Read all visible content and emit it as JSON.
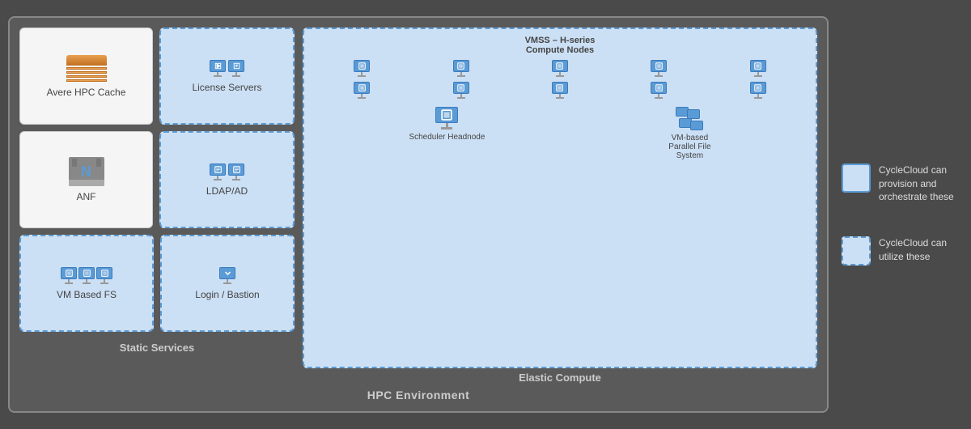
{
  "legend": {
    "provision_label": "CycleCloud can provision and orchestrate these",
    "utilize_label": "CycleCloud can utilize these"
  },
  "main_label": "HPC Environment",
  "static_label": "Static Services",
  "elastic_label": "Elastic Compute",
  "cards": {
    "avere": "Avere HPC Cache",
    "license": "License Servers",
    "anf": "ANF",
    "ldap": "LDAP/AD",
    "vmfs": "VM Based FS",
    "login": "Login / Bastion",
    "vmss": "VMSS – H-series\nCompute Nodes",
    "scheduler": "Scheduler Headnode",
    "pfs": "VM-based\nParallel File\nSystem"
  }
}
